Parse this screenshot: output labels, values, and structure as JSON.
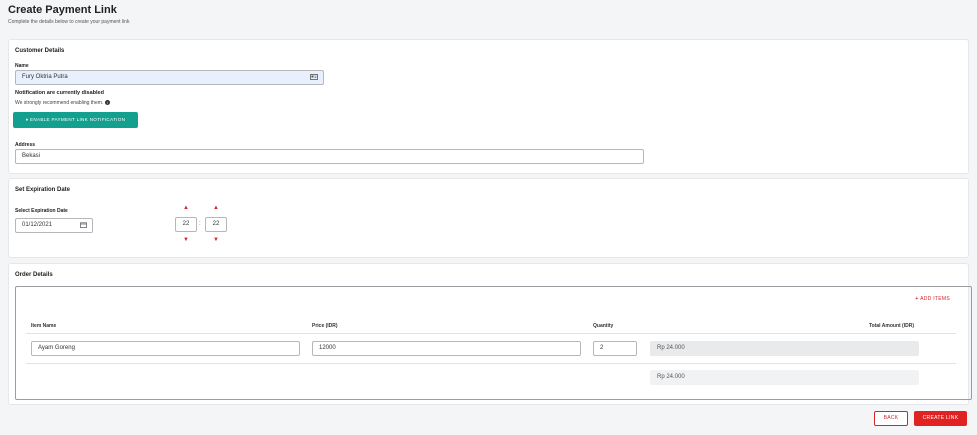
{
  "page": {
    "title": "Create Payment Link",
    "subtitle": "Complete the details below to create your payment link"
  },
  "customer": {
    "section_title": "Customer Details",
    "name_label": "Name",
    "name_value": "Fury Oktria Putra",
    "name_icon": "contact-card-icon",
    "notification_title": "Notification are currently disabled",
    "notification_text": "We strongly recommend enabling them.",
    "info_icon": "info-icon",
    "enable_button": "ENABLE PAYMENT LINK NOTIFICATION",
    "bell_icon": "bell-icon",
    "address_label": "Address",
    "address_value": "Bekasi"
  },
  "expiration": {
    "section_title": "Set Expiration Date",
    "date_label": "Select Expiration Date",
    "date_value": "01/12/2021",
    "calendar_icon": "calendar-icon",
    "hour": "22",
    "minute": "22",
    "separator": ":"
  },
  "order": {
    "section_title": "Order Details",
    "add_items": "ADD ITEMS",
    "columns": {
      "item_name": "Item Name",
      "price": "Price (IDR)",
      "quantity": "Quantity",
      "total": "Total Amount (IDR)"
    },
    "rows": [
      {
        "item_name": "Ayam Goreng",
        "price": "12000",
        "quantity": "2",
        "total": "Rp 24.000"
      }
    ],
    "grand_total": "Rp 24.000"
  },
  "actions": {
    "back": "BACK",
    "create": "CREATE LINK"
  },
  "colors": {
    "teal": "#13a08e",
    "red": "#e02222"
  }
}
